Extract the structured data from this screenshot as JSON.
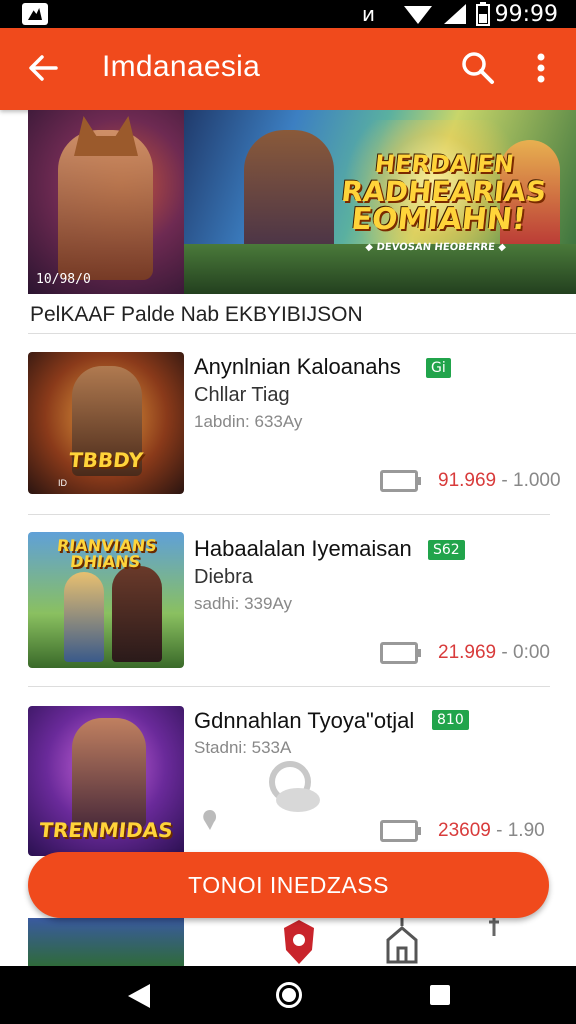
{
  "status_bar": {
    "time": "99:99",
    "icons": [
      "app-logo-icon",
      "signal-wave-icon",
      "wifi-icon",
      "cell-signal-icon",
      "battery-icon"
    ]
  },
  "app_bar": {
    "title": "Imdanaesia",
    "icons": [
      "back-arrow-icon",
      "search-icon",
      "more-vert-icon"
    ],
    "color": "#f04a1c"
  },
  "banner": {
    "game_title_lines": [
      "HERDAIEN",
      "RADHEARIAS",
      "EOMIAHN!",
      "◆ DEVOSAN HEOBERRE ◆"
    ],
    "corner_tag": "10/98/0"
  },
  "section_title": "PelKAAF Palde Nab EKBYIBIJSON",
  "items": [
    {
      "name": "Anynlnian Kaloanahs",
      "badge": "Gi",
      "subtitle": "Chllar Tiag",
      "meta": "1abdin: 633Ay",
      "price": "91.969",
      "price_suffix": "1.000",
      "thumb_title": "TBBDY",
      "thumb_sub": "ID"
    },
    {
      "name": "Habaalalan Iyemaisan",
      "badge": "S62",
      "subtitle": "Diebra",
      "meta": "sadhi: 339Ay",
      "price": "21.969",
      "price_suffix": "0:00",
      "thumb_title": "RIANVIANS\nDHIANS",
      "thumb_sub": ""
    },
    {
      "name": "Gdnnahlan Tyoya\"otjal",
      "badge": "810",
      "subtitle": "",
      "meta": "Stadni: 533A",
      "price": "23609",
      "price_suffix": "1.90",
      "thumb_title": "TRENMIDAS",
      "thumb_sub": ""
    }
  ],
  "fab_label": "TONOI INEDZASS",
  "bottom_icons": [
    "red-shield-icon",
    "tower-icon",
    "pin-icon"
  ],
  "nav_bar": [
    "nav-back-icon",
    "nav-home-icon",
    "nav-recents-icon"
  ]
}
